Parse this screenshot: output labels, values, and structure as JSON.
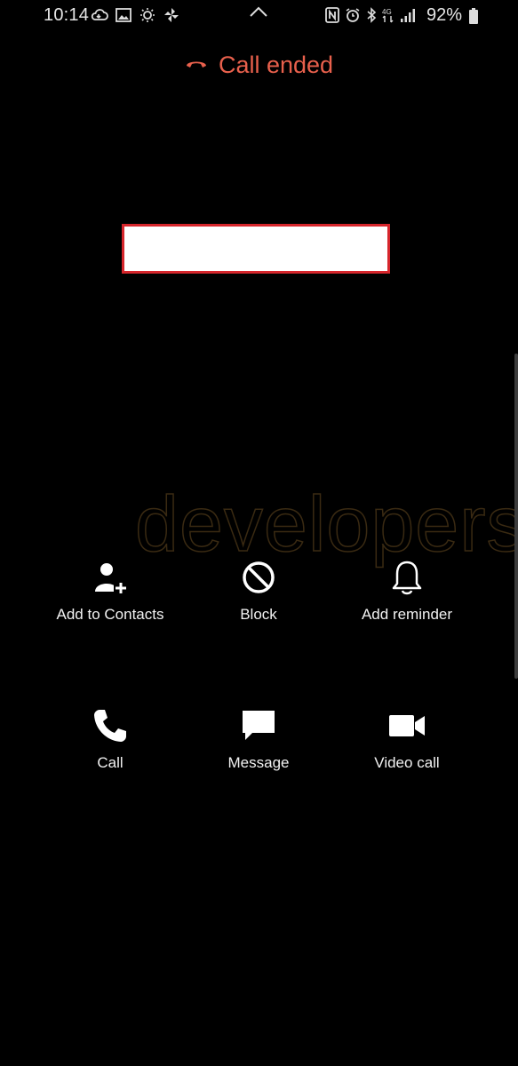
{
  "status_bar": {
    "time": "10:14",
    "battery_percent": "92%",
    "icons_left": [
      "cloud-sync-icon",
      "gallery-icon",
      "brightness-icon",
      "pinwheel-icon"
    ],
    "icons_right": [
      "nfc-icon",
      "alarm-icon",
      "bluetooth-icon",
      "data-icon",
      "signal-icon",
      "battery-icon"
    ]
  },
  "call": {
    "status_text": "Call ended",
    "status_color": "#e8604c"
  },
  "watermark": "developers",
  "actions_row1": [
    {
      "label": "Add to Contacts",
      "icon": "add-contact-icon"
    },
    {
      "label": "Block",
      "icon": "block-icon"
    },
    {
      "label": "Add reminder",
      "icon": "bell-icon"
    }
  ],
  "actions_row2": [
    {
      "label": "Call",
      "icon": "phone-icon"
    },
    {
      "label": "Message",
      "icon": "message-icon"
    },
    {
      "label": "Video call",
      "icon": "video-camera-icon"
    }
  ]
}
